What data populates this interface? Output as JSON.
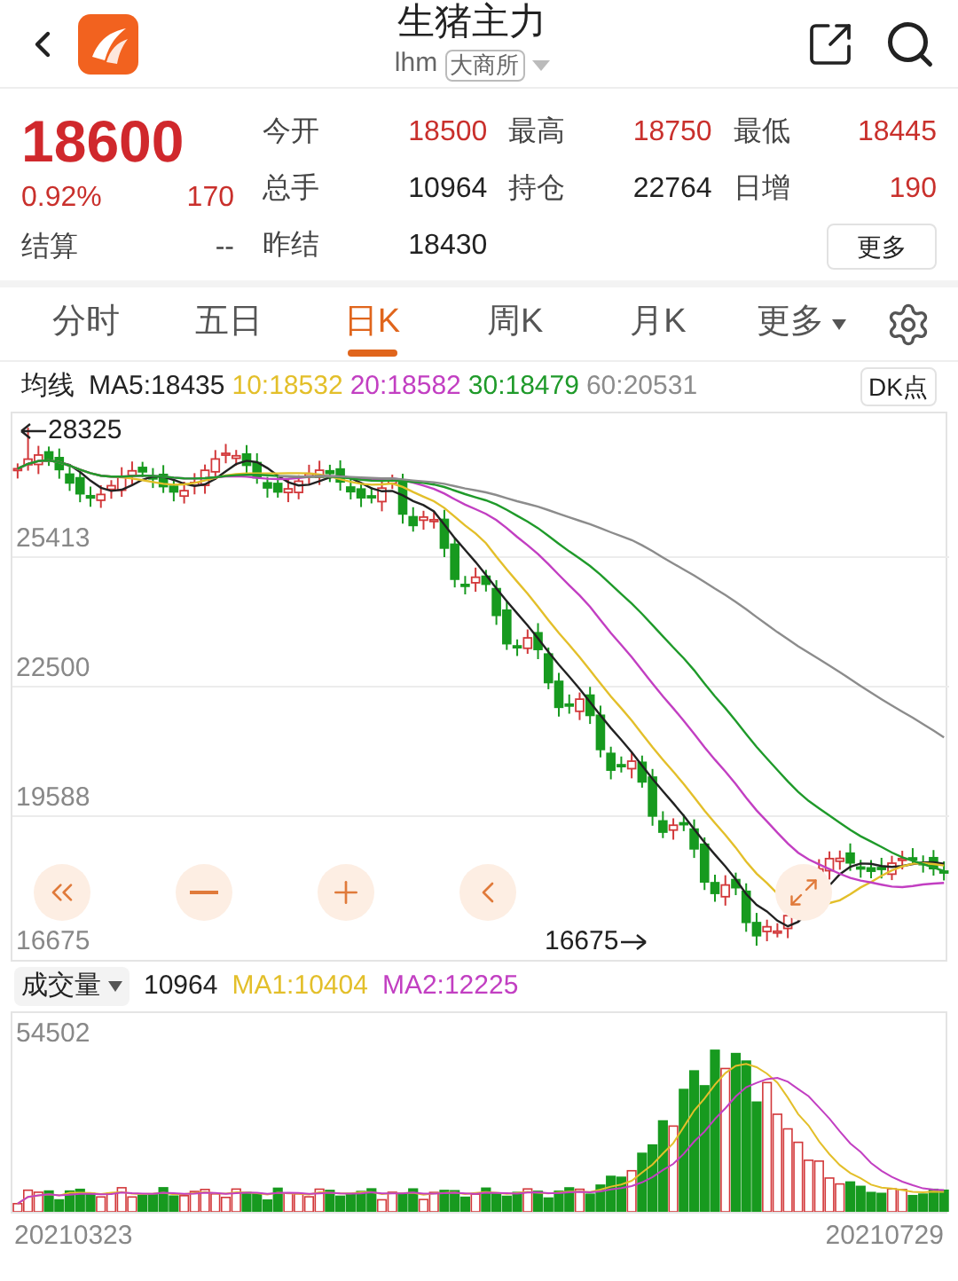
{
  "header": {
    "title": "生猪主力",
    "code": "lhm",
    "exchange": "大商所"
  },
  "quote": {
    "price": "18600",
    "change_pct": "0.92%",
    "change": "170",
    "settle_label": "结算",
    "settle_value": "--",
    "more_button": "更多",
    "stats": [
      {
        "label": "今开",
        "value": "18500",
        "color": "#c9302c"
      },
      {
        "label": "最高",
        "value": "18750",
        "color": "#c9302c"
      },
      {
        "label": "最低",
        "value": "18445",
        "color": "#c9302c"
      },
      {
        "label": "总手",
        "value": "10964",
        "color": "#222222"
      },
      {
        "label": "持仓",
        "value": "22764",
        "color": "#222222"
      },
      {
        "label": "日增",
        "value": "190",
        "color": "#c9302c"
      },
      {
        "label": "昨结",
        "value": "18430",
        "color": "#222222"
      }
    ]
  },
  "tabs": [
    {
      "label": "分时",
      "selected": false,
      "kind": "tab"
    },
    {
      "label": "五日",
      "selected": false,
      "kind": "tab"
    },
    {
      "label": "日K",
      "selected": true,
      "kind": "tab"
    },
    {
      "label": "周K",
      "selected": false,
      "kind": "tab"
    },
    {
      "label": "月K",
      "selected": false,
      "kind": "tab"
    },
    {
      "label": "更多",
      "selected": false,
      "kind": "dropdown"
    }
  ],
  "ma_legend": {
    "label": "均线",
    "dk_button": "DK点",
    "items": [
      {
        "text": "MA5:18435",
        "color": "#222222"
      },
      {
        "text": "10:18532",
        "color": "#e3bf2a"
      },
      {
        "text": "20:18582",
        "color": "#c23fc2"
      },
      {
        "text": "30:18479",
        "color": "#1f9a2a"
      },
      {
        "text": "60:20531",
        "color": "#8c8c8c"
      }
    ]
  },
  "price_chart": {
    "y_labels": [
      "25413",
      "22500",
      "19588",
      "16675"
    ],
    "high_marker": "28325",
    "low_marker": "16675"
  },
  "volume": {
    "selector": "成交量",
    "value": "10964",
    "y_label": "54502",
    "start_date": "20210323",
    "end_date": "20210729",
    "ma": [
      {
        "text": "MA1:10404",
        "color": "#e3bf2a"
      },
      {
        "text": "MA2:12225",
        "color": "#c23fc2"
      }
    ]
  }
}
